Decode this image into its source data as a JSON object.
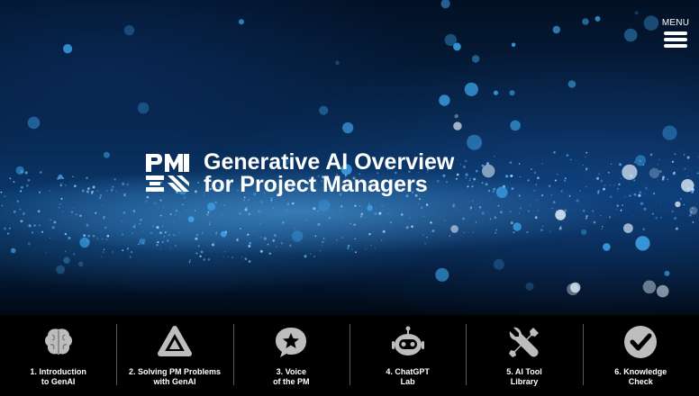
{
  "menu": {
    "label": "MENU"
  },
  "hero": {
    "title_line1": "Generative AI Overview",
    "title_line2": "for Project Managers",
    "logo_text": "PMI",
    "icon": "pmi-logo-icon"
  },
  "nav": {
    "items": [
      {
        "label": "1. Introduction\nto GenAI",
        "icon": "brain-icon"
      },
      {
        "label": "2. Solving PM Problems\nwith GenAI",
        "icon": "triangle-icon"
      },
      {
        "label": "3. Voice\nof the PM",
        "icon": "star-chat-icon"
      },
      {
        "label": "4. ChatGPT\nLab",
        "icon": "robot-icon"
      },
      {
        "label": "5. AI Tool\nLibrary",
        "icon": "tools-icon"
      },
      {
        "label": "6. Knowledge\nCheck",
        "icon": "check-circle-icon"
      }
    ]
  },
  "colors": {
    "nav_background": "#000000",
    "icon_gray": "#bdbdbd",
    "accent_blue": "#1e6fb8"
  }
}
